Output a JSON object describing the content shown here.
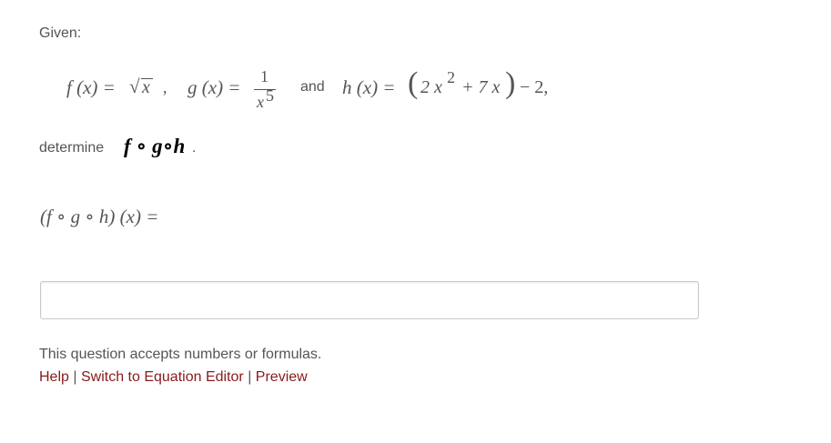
{
  "question": {
    "given_label": "Given:",
    "f_def": {
      "lhs": "f (x) =",
      "radical": "√",
      "radicand": "x",
      "trail": ","
    },
    "g_def": {
      "lhs": "g (x) =",
      "numerator": "1",
      "den_base": "x",
      "den_exp": "5"
    },
    "and_label": "and",
    "h_def": {
      "lhs": "h (x) =",
      "open_paren": "(",
      "inner_a": "2 x",
      "inner_exp": "2",
      "inner_b": "+ 7 x",
      "close_paren": ")",
      "tail": "− 2,"
    },
    "determine_label": "determine",
    "composition": "f ∘ g∘h",
    "period": ".",
    "answer_lhs": "(f ∘ g ∘ h) (x) ="
  },
  "answer": {
    "value": "",
    "placeholder": ""
  },
  "footer": {
    "accepts_text": "This question accepts numbers or formulas.",
    "help_link": "Help",
    "separator": "|",
    "equation_editor_link": "Switch to Equation Editor",
    "preview_link": "Preview"
  },
  "colors": {
    "text": "#555555",
    "link": "#8a1a1a",
    "input_border": "#c8c8c8"
  }
}
